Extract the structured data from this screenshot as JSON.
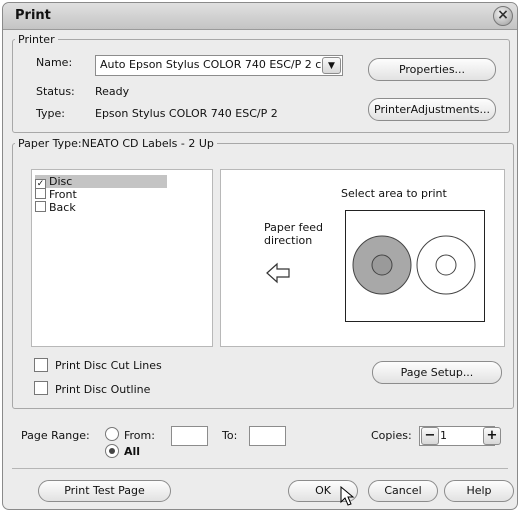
{
  "window": {
    "title": "Print",
    "close_icon": "×"
  },
  "printer": {
    "legend": "Printer",
    "name_label": "Name:",
    "name_value": "Auto Epson Stylus COLOR 740 ESC/P 2 c",
    "status_label": "Status:",
    "status_value": "Ready",
    "type_label": "Type:",
    "type_value": "Epson Stylus COLOR 740 ESC/P 2",
    "properties_button": "Properties...",
    "adjustments_button": "PrinterAdjustments..."
  },
  "paper": {
    "legend": "Paper Type:NEATO CD Labels - 2 Up",
    "items": [
      {
        "label": "Disc",
        "checked": true,
        "mark": "✓"
      },
      {
        "label": "Front",
        "checked": false,
        "mark": ""
      },
      {
        "label": "Back",
        "checked": false,
        "mark": ""
      }
    ],
    "select_area_text": "Select area to print",
    "feed_line1": "Paper feed",
    "feed_line2": "direction",
    "feed_arrow_icon": "left-arrow-icon",
    "selected_disc_color": "#a8a8a8",
    "print_cut_lines_label": "Print Disc Cut Lines",
    "print_outline_label": "Print Disc Outline",
    "page_setup_button": "Page Setup..."
  },
  "range": {
    "label": "Page Range:",
    "from_label": "From:",
    "to_label": "To:",
    "all_label": "All",
    "from_value": "",
    "to_value": "",
    "selected": "All"
  },
  "copies": {
    "label": "Copies:",
    "value": "1",
    "minus": "−",
    "plus": "+"
  },
  "footer": {
    "test_page_button": "Print Test Page",
    "ok_button": "OK",
    "cancel_button": "Cancel",
    "help_button": "Help"
  }
}
